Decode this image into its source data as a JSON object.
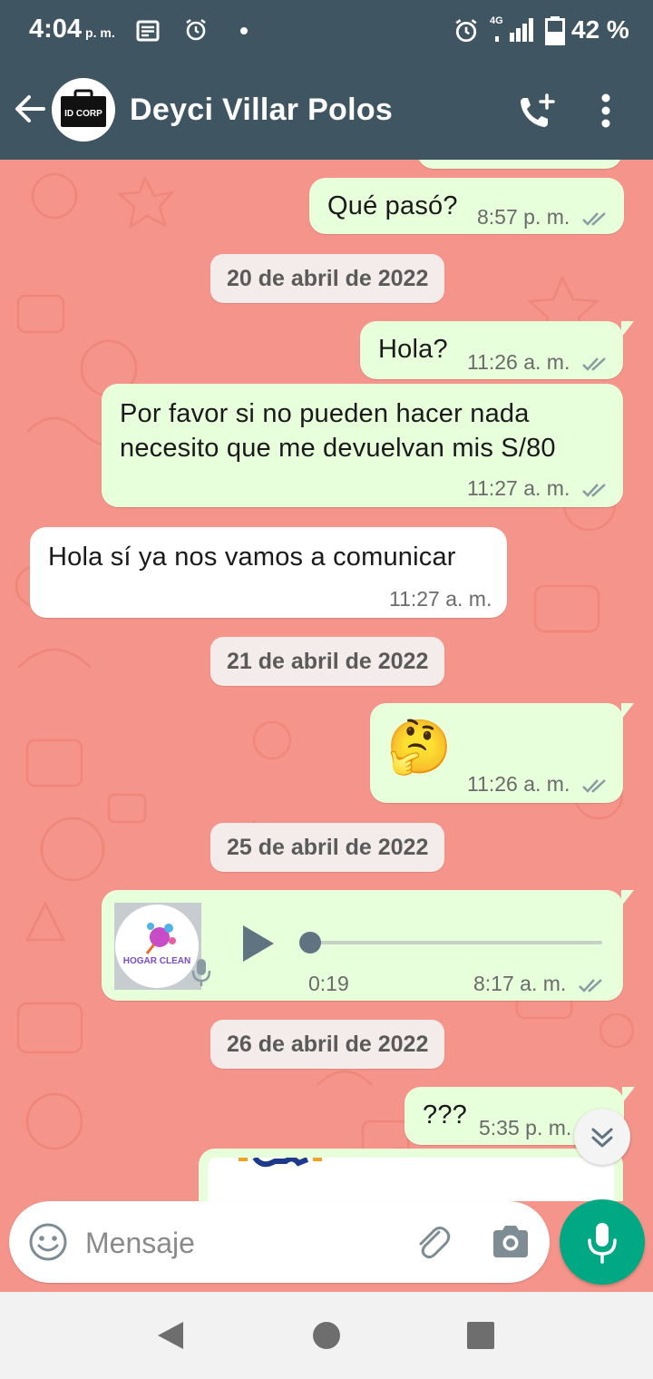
{
  "status_bar": {
    "time": "4:04",
    "ampm": "p. m.",
    "network": "4G",
    "battery": "42 %"
  },
  "header": {
    "contact_name": "Deyci Villar Polos",
    "avatar_text": "ID CORP"
  },
  "messages": [
    {
      "type": "out",
      "text": "Qué pasó?",
      "time": "8:57 p. m."
    },
    {
      "type": "date",
      "text": "20 de abril de 2022"
    },
    {
      "type": "out",
      "text": "Hola?",
      "time": "11:26 a. m."
    },
    {
      "type": "out",
      "text_line1": "Por favor si no pueden hacer nada",
      "text_line2": "necesito que me devuelvan mis S/80",
      "time": "11:27 a. m."
    },
    {
      "type": "in",
      "text": "Hola sí ya nos vamos a comunicar",
      "time": "11:27 a. m."
    },
    {
      "type": "date",
      "text": "21 de abril de 2022"
    },
    {
      "type": "out",
      "emoji": "🤔",
      "time": "11:26 a. m."
    },
    {
      "type": "date",
      "text": "25 de abril de 2022"
    },
    {
      "type": "out-voice",
      "duration": "0:19",
      "time": "8:17 a. m.",
      "brand": "HOGAR CLEAN",
      "progress": 0
    },
    {
      "type": "date",
      "text": "26 de abril de 2022"
    },
    {
      "type": "out",
      "text": "???",
      "time": "5:35 p. m."
    }
  ],
  "input": {
    "placeholder": "Mensaje"
  },
  "colors": {
    "header": "#3F5562",
    "chat_bg": "#F5948A",
    "out_bubble": "#E7FFDB",
    "in_bubble": "#FFFFFF",
    "mic_button": "#00A884",
    "read_ticks": "#8A9BA3"
  },
  "icons": [
    "back-arrow-icon",
    "add-call-icon",
    "more-vert-icon",
    "emoji-icon",
    "attach-icon",
    "camera-icon",
    "mic-icon",
    "play-icon",
    "double-check-icon",
    "chevron-double-down-icon"
  ]
}
